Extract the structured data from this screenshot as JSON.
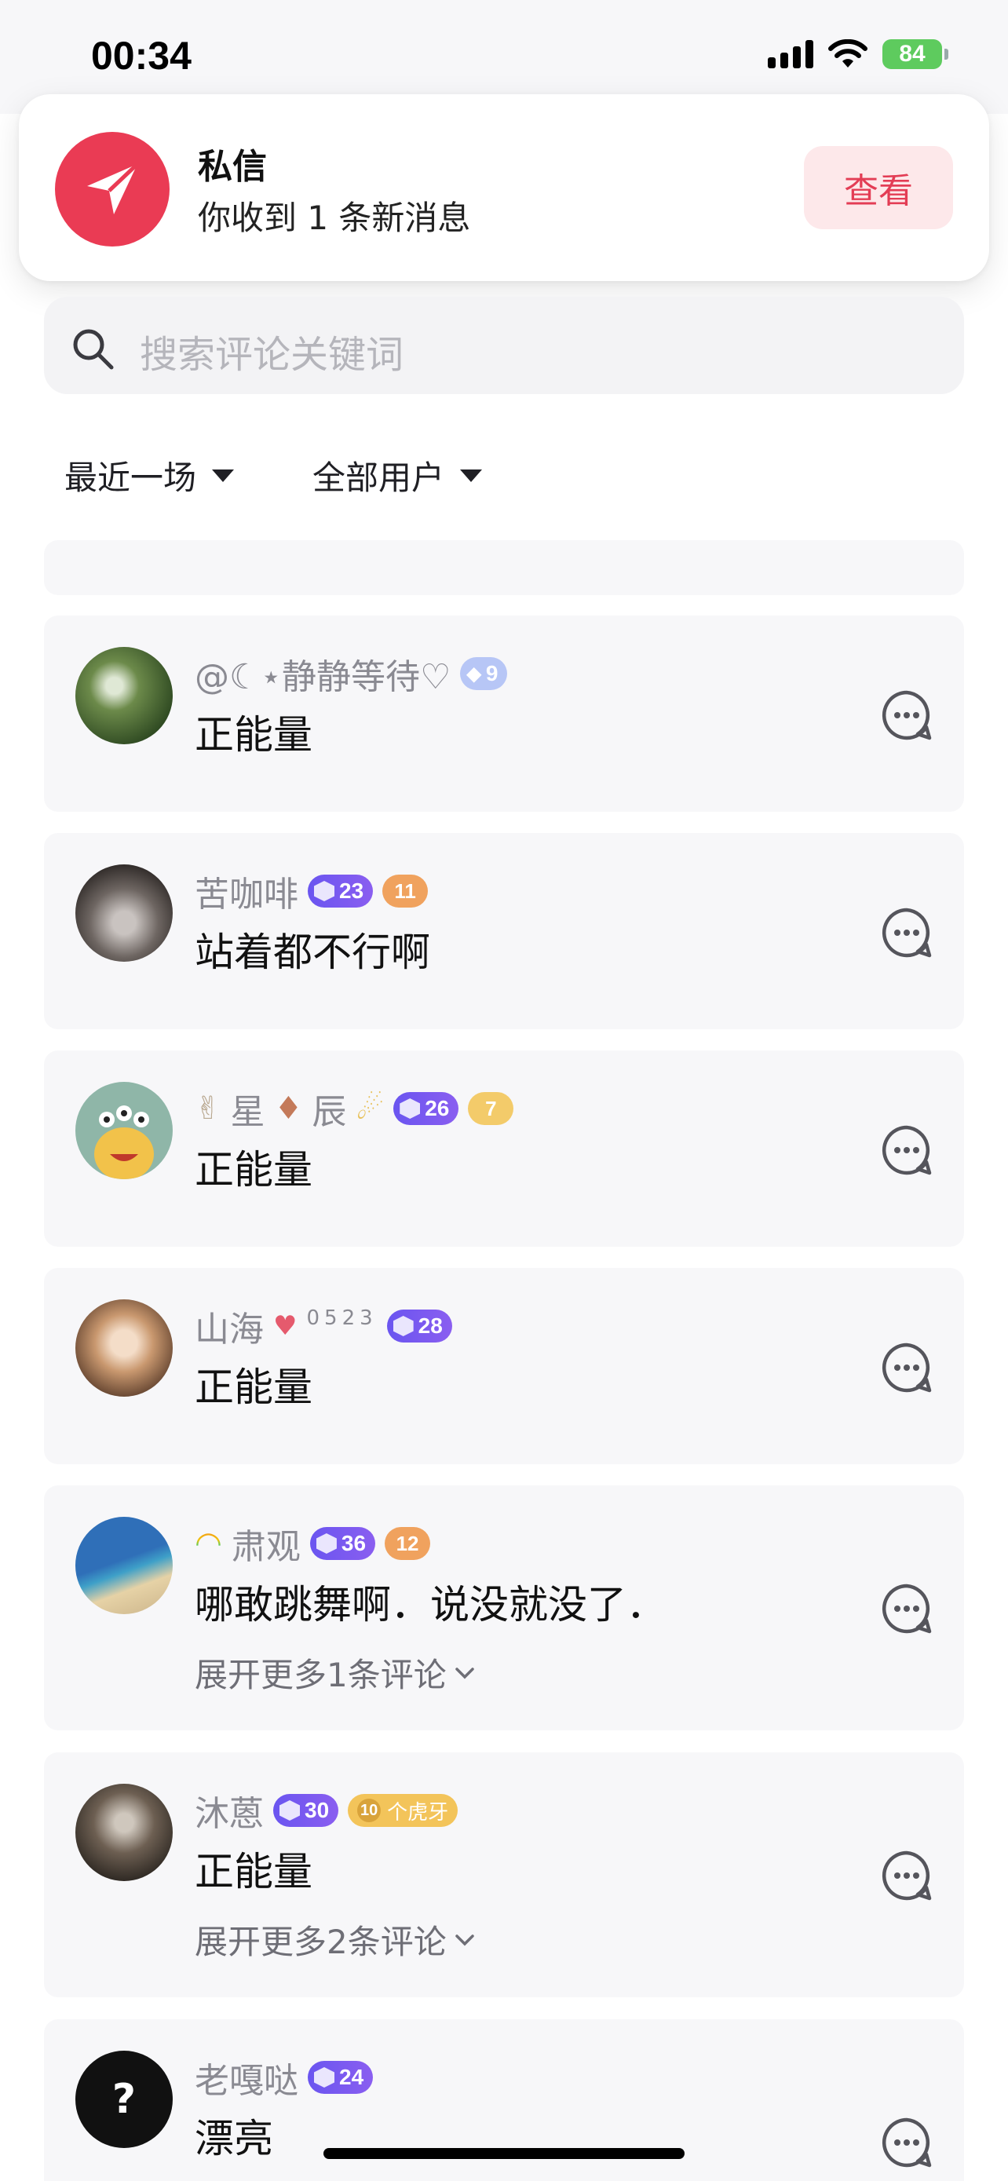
{
  "status_bar": {
    "time": "00:34",
    "battery": "84"
  },
  "notification": {
    "title": "私信",
    "body": "你收到 1 条新消息",
    "action_label": "查看",
    "accent": "#ea3b54"
  },
  "search": {
    "placeholder": "搜索评论关键词"
  },
  "filters": [
    {
      "label": "最近一场"
    },
    {
      "label": "全部用户"
    }
  ],
  "comments": [
    {
      "username": "@☾⋆静静等待♡",
      "level": "9",
      "text": "正能量"
    },
    {
      "username": "苦咖啡",
      "level": "23",
      "fan_level": "11",
      "text": "站着都不行啊"
    },
    {
      "username_parts": [
        "星",
        "辰"
      ],
      "level": "26",
      "fan_level": "7",
      "text": "正能量"
    },
    {
      "username": "山海",
      "username_suffix": "0523",
      "level": "28",
      "text": "正能量"
    },
    {
      "username": "肃观",
      "level": "36",
      "fan_level": "12",
      "text": "哪敢跳舞啊．说没就没了．",
      "expand": "展开更多1条评论"
    },
    {
      "username": "沐蒽",
      "level": "30",
      "fan_level": "10",
      "fan_name": "个虎牙",
      "text": "正能量",
      "expand": "展开更多2条评论"
    },
    {
      "username": "老嘎哒",
      "level": "24",
      "text": "漂亮"
    }
  ]
}
